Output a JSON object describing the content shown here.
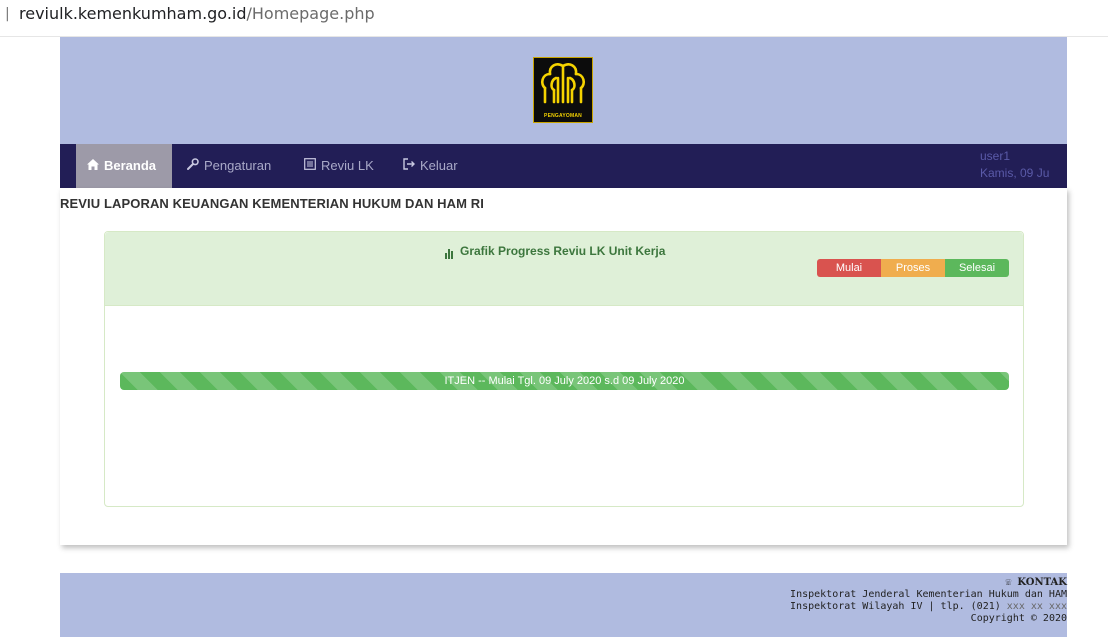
{
  "browser": {
    "separator": "|",
    "host": "reviulk.kemenkumham.go.id",
    "path": "/Homepage.php"
  },
  "header": {
    "logo_text": "PENGAYOMAN"
  },
  "nav": {
    "items": [
      {
        "label": "Beranda",
        "icon": "home-icon"
      },
      {
        "label": "Pengaturan",
        "icon": "wrench-icon"
      },
      {
        "label": "Reviu LK",
        "icon": "list-icon"
      },
      {
        "label": "Keluar",
        "icon": "logout-icon"
      }
    ],
    "user": "user1",
    "date": "Kamis, 09 Ju"
  },
  "page": {
    "title": "REVIU LAPORAN KEUANGAN KEMENTERIAN HUKUM DAN HAM RI"
  },
  "panel": {
    "title": "Grafik Progress Reviu LK Unit Kerja",
    "legend": [
      {
        "label": "Mulai",
        "color": "#d9534f"
      },
      {
        "label": "Proses",
        "color": "#f0ad4e"
      },
      {
        "label": "Selesai",
        "color": "#5cb85c"
      }
    ],
    "progress": {
      "label": "ITJEN  -- Mulai Tgl. 09 July 2020 s.d 09 July 2020",
      "percent": 100,
      "color": "#5cb85c"
    }
  },
  "footer": {
    "kontak": "KONTAK",
    "line1": "Inspektorat Jenderal Kementerian Hukum dan HAM",
    "line2a": "Inspektorat Wilayah IV | tlp. (021) ",
    "line2b": "xxx xx xxx",
    "copyright": "Copyright © 2020"
  }
}
